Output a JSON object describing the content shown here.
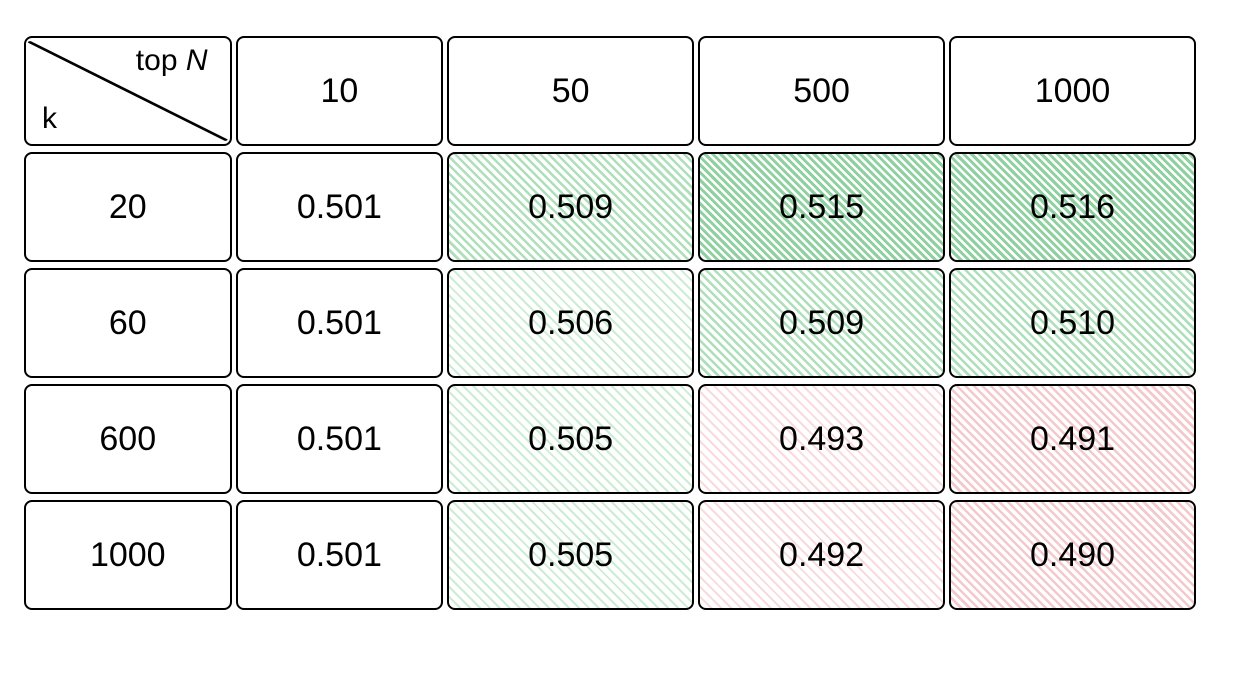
{
  "header": {
    "col_axis_label": "top N",
    "row_axis_label": "k",
    "columns": [
      "10",
      "50",
      "500",
      "1000"
    ],
    "rows": [
      "20",
      "60",
      "600",
      "1000"
    ]
  },
  "cells": {
    "r0c0": "0.501",
    "r0c1": "0.509",
    "r0c2": "0.515",
    "r0c3": "0.516",
    "r1c0": "0.501",
    "r1c1": "0.506",
    "r1c2": "0.509",
    "r1c3": "0.510",
    "r2c0": "0.501",
    "r2c1": "0.505",
    "r2c2": "0.493",
    "r2c3": "0.491",
    "r3c0": "0.501",
    "r3c1": "0.505",
    "r3c2": "0.492",
    "r3c3": "0.490"
  },
  "chart_data": {
    "type": "heatmap",
    "title": "",
    "row_axis": "k",
    "col_axis": "top N",
    "row_labels": [
      20,
      60,
      600,
      1000
    ],
    "col_labels": [
      10,
      50,
      500,
      1000
    ],
    "values": [
      [
        0.501,
        0.509,
        0.515,
        0.516
      ],
      [
        0.501,
        0.506,
        0.509,
        0.51
      ],
      [
        0.501,
        0.505,
        0.493,
        0.491
      ],
      [
        0.501,
        0.505,
        0.492,
        0.49
      ]
    ],
    "color_scale": {
      "low": {
        "value": 0.49,
        "color": "red"
      },
      "mid": {
        "value": 0.5,
        "color": "white"
      },
      "high": {
        "value": 0.516,
        "color": "green"
      }
    }
  }
}
